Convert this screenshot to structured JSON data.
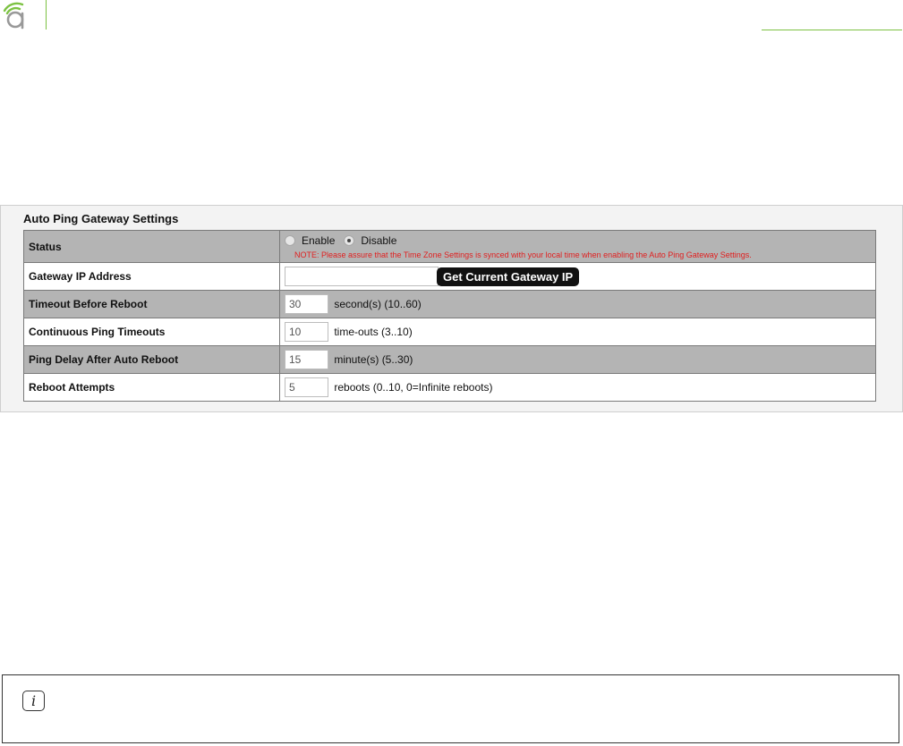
{
  "brand": {
    "accent_color": "#7cc242",
    "logo_icon": "amped-logo-icon"
  },
  "panel": {
    "title": "Auto Ping Gateway Settings",
    "status": {
      "label": "Status",
      "options": [
        "Enable",
        "Disable"
      ],
      "selected": "Disable",
      "note": "NOTE: Please assure that the Time Zone Settings is synced with your local time when enabling the Auto Ping Gateway Settings."
    },
    "gateway_ip": {
      "label": "Gateway IP Address",
      "value": "",
      "button_label": "Get Current Gateway IP"
    },
    "timeout": {
      "label": "Timeout Before Reboot",
      "value": "30",
      "unit": "second(s) (10..60)"
    },
    "continuous": {
      "label": "Continuous Ping Timeouts",
      "value": "10",
      "unit": "time-outs (3..10)"
    },
    "delay": {
      "label": "Ping Delay After Auto Reboot",
      "value": "15",
      "unit": "minute(s) (5..30)"
    },
    "attempts": {
      "label": "Reboot Attempts",
      "value": "5",
      "unit": "reboots (0..10, 0=Infinite reboots)"
    }
  },
  "info_box": {
    "icon": "info-icon",
    "icon_glyph": "i"
  }
}
